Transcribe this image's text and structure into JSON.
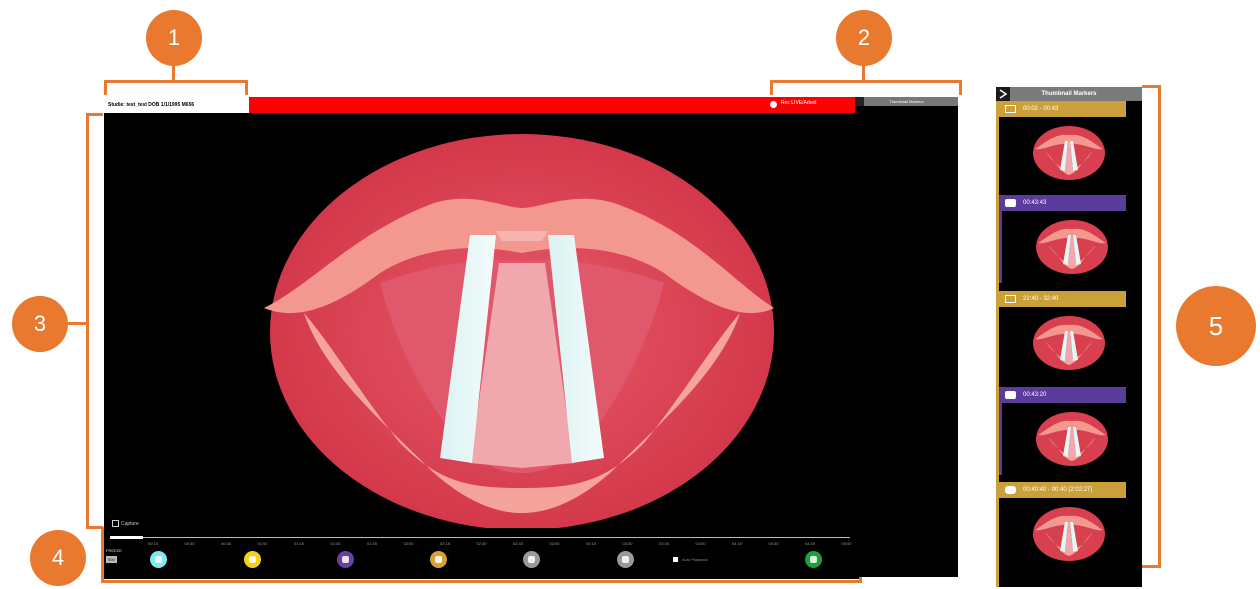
{
  "callouts": [
    "1",
    "2",
    "3",
    "4",
    "5"
  ],
  "info_bar": {
    "text": "Studie: test_test   DOB 1/1/1995   M656"
  },
  "recording": {
    "label": "Rec LIVE/Arbeit"
  },
  "side_panel": {
    "title": "Thumbnail Markers"
  },
  "video": {
    "corner_label": "Capture"
  },
  "timeline": {
    "ticks": [
      "00:15",
      "00:30",
      "00:45",
      "01:00",
      "01:15",
      "01:30",
      "01:45",
      "02:00",
      "02:15",
      "02:30",
      "02:45",
      "03:00",
      "03:15",
      "03:30",
      "03:45",
      "04:00",
      "04:15",
      "04:30",
      "04:45",
      "05:00"
    ],
    "mode_label": "FREEZE",
    "mode_value": "000",
    "aux_label": "Auto Playback"
  },
  "controls": [
    {
      "name": "record-button",
      "color": "#7fe9f5"
    },
    {
      "name": "snapshot-button",
      "color": "#f5d21a"
    },
    {
      "name": "camera-button",
      "color": "#6a3fa0"
    },
    {
      "name": "pause-button",
      "color": "#d8a23a"
    },
    {
      "name": "bookmark-button",
      "color": "#9a9a9a"
    },
    {
      "name": "settings-button",
      "color": "#9a9a9a"
    },
    {
      "name": "grid-button",
      "color": "#1ea03a"
    }
  ],
  "thumbnails": {
    "title": "Thumbnail Markers",
    "items": [
      {
        "label": "00:02 - 00:43",
        "type": "video",
        "color": "#c9a03a"
      },
      {
        "label": "00:43:43",
        "type": "photo",
        "color": "#5b3c9c"
      },
      {
        "label": "22:40 - 32:40",
        "type": "video",
        "color": "#c9a03a"
      },
      {
        "label": "00:43:20",
        "type": "photo",
        "color": "#5b3c9c"
      },
      {
        "label": "00:40:40 - 00:40 (2:02:27)",
        "type": "camera",
        "color": "#c9a03a"
      }
    ]
  }
}
